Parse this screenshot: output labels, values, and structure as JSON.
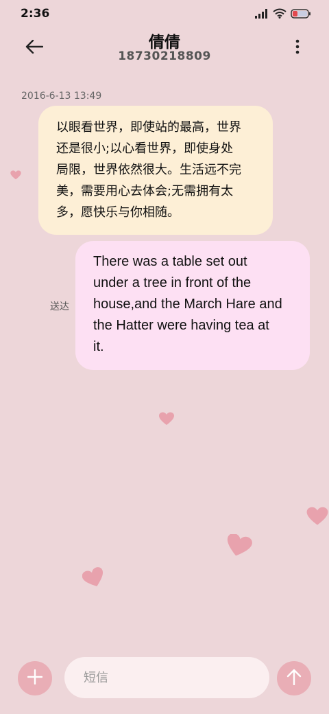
{
  "status_bar": {
    "time": "2:36",
    "icons": [
      "signal-icon",
      "wifi-icon",
      "battery-icon"
    ]
  },
  "header": {
    "contact_name": "倩倩",
    "contact_number": "18730218809",
    "back_icon": "back-arrow-icon",
    "more_icon": "more-vertical-icon"
  },
  "conversation": {
    "timestamp": "2016-6-13 13:49",
    "incoming_message": {
      "lines": [
        "以眼看世界，即使站的最高，世界",
        "还是很小;以心看世界，即使身处",
        "局限，世界依然很大。生活远不完",
        "美，需要用心去体会;无需拥有太",
        "多，愿快乐与你相随。"
      ]
    },
    "outgoing_message": {
      "lines": [
        "There was a table set out",
        "under a tree in front of the",
        "house,and the March Hare and",
        "the Hatter were having tea at",
        "it."
      ],
      "status": "送达"
    }
  },
  "composer": {
    "placeholder": "短信",
    "attach_icon": "plus-icon",
    "send_icon": "send-arrow-icon"
  },
  "colors": {
    "background": "#edd6d9",
    "incoming_bubble": "#fdefd6",
    "outgoing_bubble": "#fde0f3",
    "button": "#e9aeb6",
    "heart": "#e8a2ad"
  }
}
